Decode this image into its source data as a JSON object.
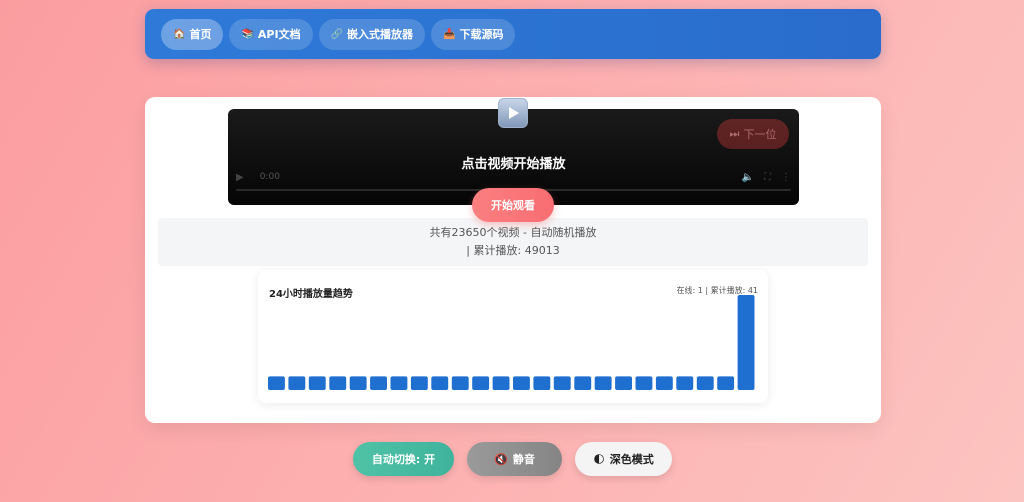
{
  "nav": {
    "items": [
      {
        "icon": "🏠",
        "label": "首页",
        "active": true
      },
      {
        "icon": "📚",
        "label": "API文档",
        "active": false
      },
      {
        "icon": "🔗",
        "label": "嵌入式播放器",
        "active": false
      },
      {
        "icon": "📥",
        "label": "下载源码",
        "active": false
      }
    ]
  },
  "player": {
    "title": "点击视频开始播放",
    "time": "0:00",
    "next_icon": "⏭",
    "next_label": "下一位",
    "start_label": "开始观看"
  },
  "info": {
    "line1": "共有23650个视频 - 自动随机播放",
    "line2": "| 累计播放: 49013"
  },
  "chart": {
    "title": "24小时播放量趋势",
    "stats": "在线: 1 | 累计播放: 41"
  },
  "chart_data": {
    "type": "bar",
    "title": "24小时播放量趋势",
    "series": [
      {
        "values": [
          1,
          1,
          1,
          1,
          1,
          1,
          1,
          1,
          1,
          1,
          1,
          1,
          1,
          1,
          1,
          1,
          1,
          1,
          1,
          1,
          1,
          1,
          1,
          7
        ]
      }
    ],
    "bar_color": "#1f6fd1"
  },
  "controls": {
    "auto_label": "自动切换: 开",
    "mute_icon": "🔇",
    "mute_label": "静音",
    "dark_icon": "🌓",
    "dark_label": "深色模式"
  },
  "colors": {
    "nav_bg": "#2f7ad9",
    "start_btn": "#fb7f80",
    "auto_btn": "#4fc2a6",
    "mute_btn": "#8e8e8e",
    "bar": "#1f6fd1"
  }
}
